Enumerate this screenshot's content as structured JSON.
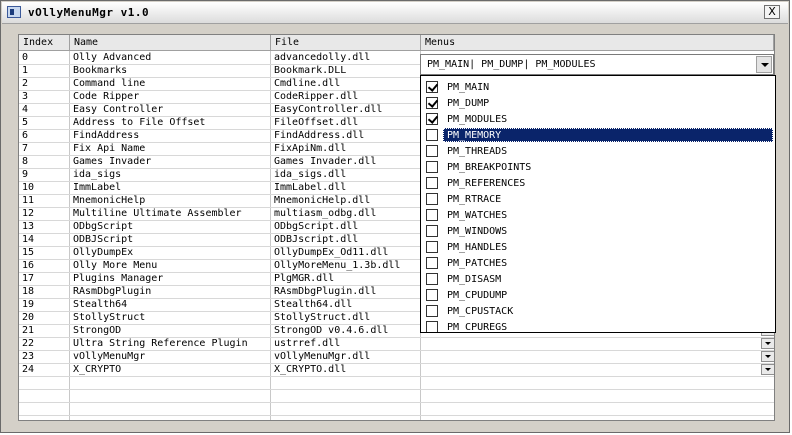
{
  "window": {
    "title": "vOllyMenuMgr v1.0",
    "close_glyph": "X"
  },
  "columns": [
    "Index",
    "Name",
    "File",
    "Menus"
  ],
  "rows": [
    {
      "index": "0",
      "name": "Olly Advanced",
      "file": "advancedolly.dll"
    },
    {
      "index": "1",
      "name": "Bookmarks",
      "file": "Bookmark.DLL"
    },
    {
      "index": "2",
      "name": "Command line",
      "file": "Cmdline.dll"
    },
    {
      "index": "3",
      "name": "Code Ripper",
      "file": "CodeRipper.dll"
    },
    {
      "index": "4",
      "name": "Easy Controller",
      "file": "EasyController.dll"
    },
    {
      "index": "5",
      "name": "Address to File Offset",
      "file": "FileOffset.dll"
    },
    {
      "index": "6",
      "name": "FindAddress",
      "file": "FindAddress.dll"
    },
    {
      "index": "7",
      "name": "Fix Api Name",
      "file": "FixApiNm.dll"
    },
    {
      "index": "8",
      "name": "Games Invader",
      "file": "Games Invader.dll"
    },
    {
      "index": "9",
      "name": "ida_sigs",
      "file": "ida_sigs.dll"
    },
    {
      "index": "10",
      "name": "ImmLabel",
      "file": "ImmLabel.dll"
    },
    {
      "index": "11",
      "name": "MnemonicHelp",
      "file": "MnemonicHelp.dll"
    },
    {
      "index": "12",
      "name": "Multiline Ultimate Assembler",
      "file": "multiasm_odbg.dll"
    },
    {
      "index": "13",
      "name": "ODbgScript",
      "file": "ODbgScript.dll"
    },
    {
      "index": "14",
      "name": "ODBJScript",
      "file": "ODBJscript.dll"
    },
    {
      "index": "15",
      "name": "OllyDumpEx",
      "file": "OllyDumpEx_Od11.dll"
    },
    {
      "index": "16",
      "name": "Olly More Menu",
      "file": "OllyMoreMenu_1.3b.dll"
    },
    {
      "index": "17",
      "name": "Plugins Manager",
      "file": "PlgMGR.dll"
    },
    {
      "index": "18",
      "name": "RAsmDbgPlugin",
      "file": "RAsmDbgPlugin.dll"
    },
    {
      "index": "19",
      "name": "Stealth64",
      "file": "Stealth64.dll"
    },
    {
      "index": "20",
      "name": "StollyStruct",
      "file": "StollyStruct.dll"
    },
    {
      "index": "21",
      "name": "StrongOD",
      "file": "StrongOD v0.4.6.dll"
    },
    {
      "index": "22",
      "name": "Ultra String Reference Plugin",
      "file": "ustrref.dll"
    },
    {
      "index": "23",
      "name": "vOllyMenuMgr",
      "file": "vOllyMenuMgr.dll"
    },
    {
      "index": "24",
      "name": "X_CRYPTO",
      "file": "X_CRYPTO.dll"
    }
  ],
  "combo": {
    "value": "PM_MAIN| PM_DUMP| PM_MODULES"
  },
  "menu_options": [
    {
      "label": "PM_MAIN",
      "checked": true
    },
    {
      "label": "PM_DUMP",
      "checked": true
    },
    {
      "label": "PM_MODULES",
      "checked": true
    },
    {
      "label": "PM_MEMORY",
      "checked": false,
      "selected": true
    },
    {
      "label": "PM_THREADS",
      "checked": false
    },
    {
      "label": "PM_BREAKPOINTS",
      "checked": false
    },
    {
      "label": "PM_REFERENCES",
      "checked": false
    },
    {
      "label": "PM_RTRACE",
      "checked": false
    },
    {
      "label": "PM_WATCHES",
      "checked": false
    },
    {
      "label": "PM_WINDOWS",
      "checked": false
    },
    {
      "label": "PM_HANDLES",
      "checked": false
    },
    {
      "label": "PM_PATCHES",
      "checked": false
    },
    {
      "label": "PM_DISASM",
      "checked": false
    },
    {
      "label": "PM_CPUDUMP",
      "checked": false
    },
    {
      "label": "PM_CPUSTACK",
      "checked": false
    },
    {
      "label": "PM_CPUREGS",
      "checked": false
    }
  ]
}
